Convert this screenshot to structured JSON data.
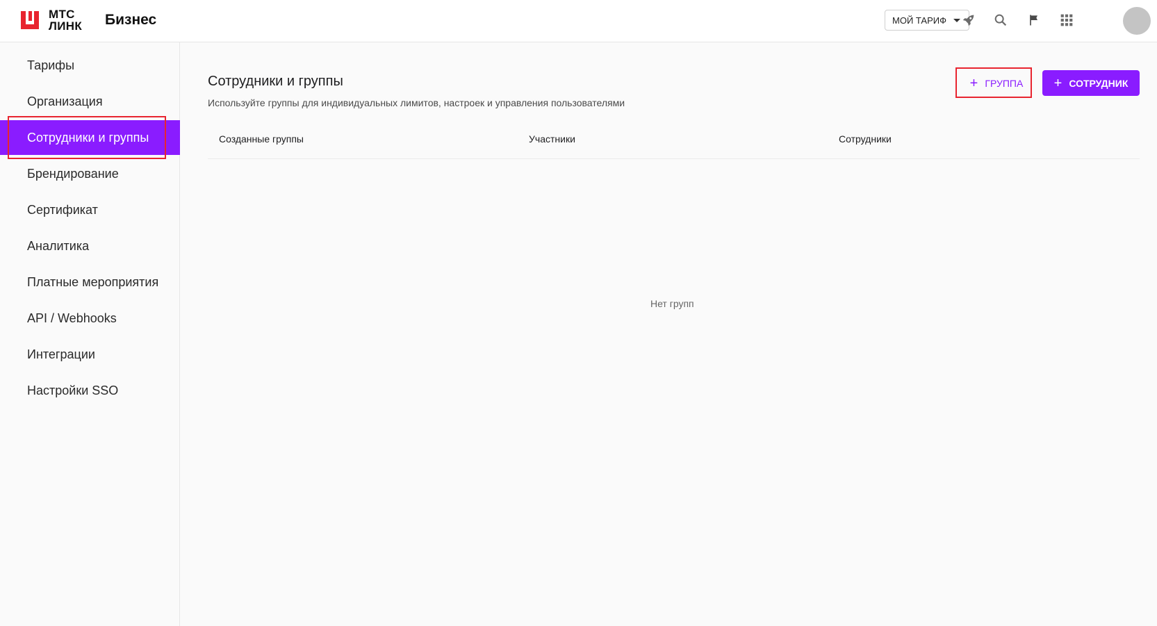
{
  "header": {
    "logo_line1": "МТС",
    "logo_line2": "ЛИНК",
    "brand_sub": "Бизнес",
    "tariff_label": "МОЙ ТАРИФ",
    "icons": [
      "rocket-icon",
      "search-icon",
      "flag-icon",
      "apps-grid-icon"
    ],
    "accent_color": "#e8242f"
  },
  "sidebar": {
    "items": [
      {
        "label": "Тарифы"
      },
      {
        "label": "Организация"
      },
      {
        "label": "Сотрудники и группы",
        "active": true
      },
      {
        "label": "Брендирование"
      },
      {
        "label": "Сертификат"
      },
      {
        "label": "Аналитика"
      },
      {
        "label": "Платные мероприятия"
      },
      {
        "label": "API / Webhooks"
      },
      {
        "label": "Интеграции"
      },
      {
        "label": "Настройки SSO"
      }
    ],
    "active_color": "#8a1cff"
  },
  "main": {
    "title": "Сотрудники и группы",
    "description": "Используйте группы для индивидуальных лимитов, настроек и управления пользователями",
    "add_group_label": "ГРУППА",
    "add_employee_label": "СОТРУДНИК",
    "columns": [
      "Созданные группы",
      "Участники",
      "Сотрудники"
    ],
    "empty_text": "Нет групп"
  }
}
